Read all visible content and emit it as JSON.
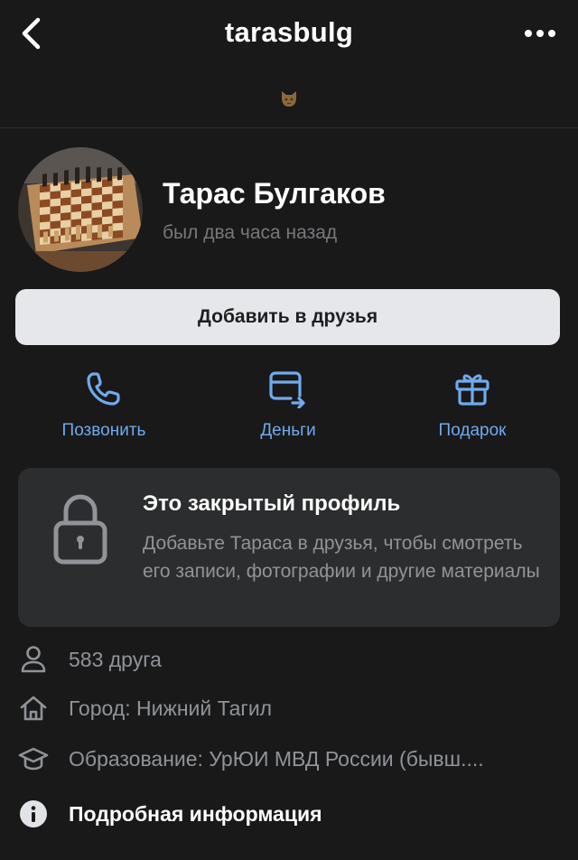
{
  "header": {
    "title": "tarasbulg",
    "back_icon": "chevron-left-icon",
    "more_icon": "more-horizontal-icon"
  },
  "status_emoji": "cat-face-emoji",
  "profile": {
    "name": "Тарас Булгаков",
    "last_seen": "был два часа назад"
  },
  "add_friend_label": "Добавить в друзья",
  "actions": [
    {
      "label": "Позвонить",
      "icon": "phone-icon"
    },
    {
      "label": "Деньги",
      "icon": "money-transfer-icon"
    },
    {
      "label": "Подарок",
      "icon": "gift-icon"
    }
  ],
  "private_profile": {
    "title": "Это закрытый профиль",
    "text": "Добавьте Тараса в друзья, чтобы смотреть его записи, фотографии и другие материалы",
    "icon": "lock-icon"
  },
  "info": {
    "friends": "583 друга",
    "city": "Город: Нижний Тагил",
    "education": "Образование: УрЮИ МВД России (бывш....",
    "details": "Подробная информация"
  },
  "colors": {
    "background": "#19191a",
    "accent": "#71aaeb",
    "card": "#2c2d2e",
    "button": "#e6e7ea"
  }
}
